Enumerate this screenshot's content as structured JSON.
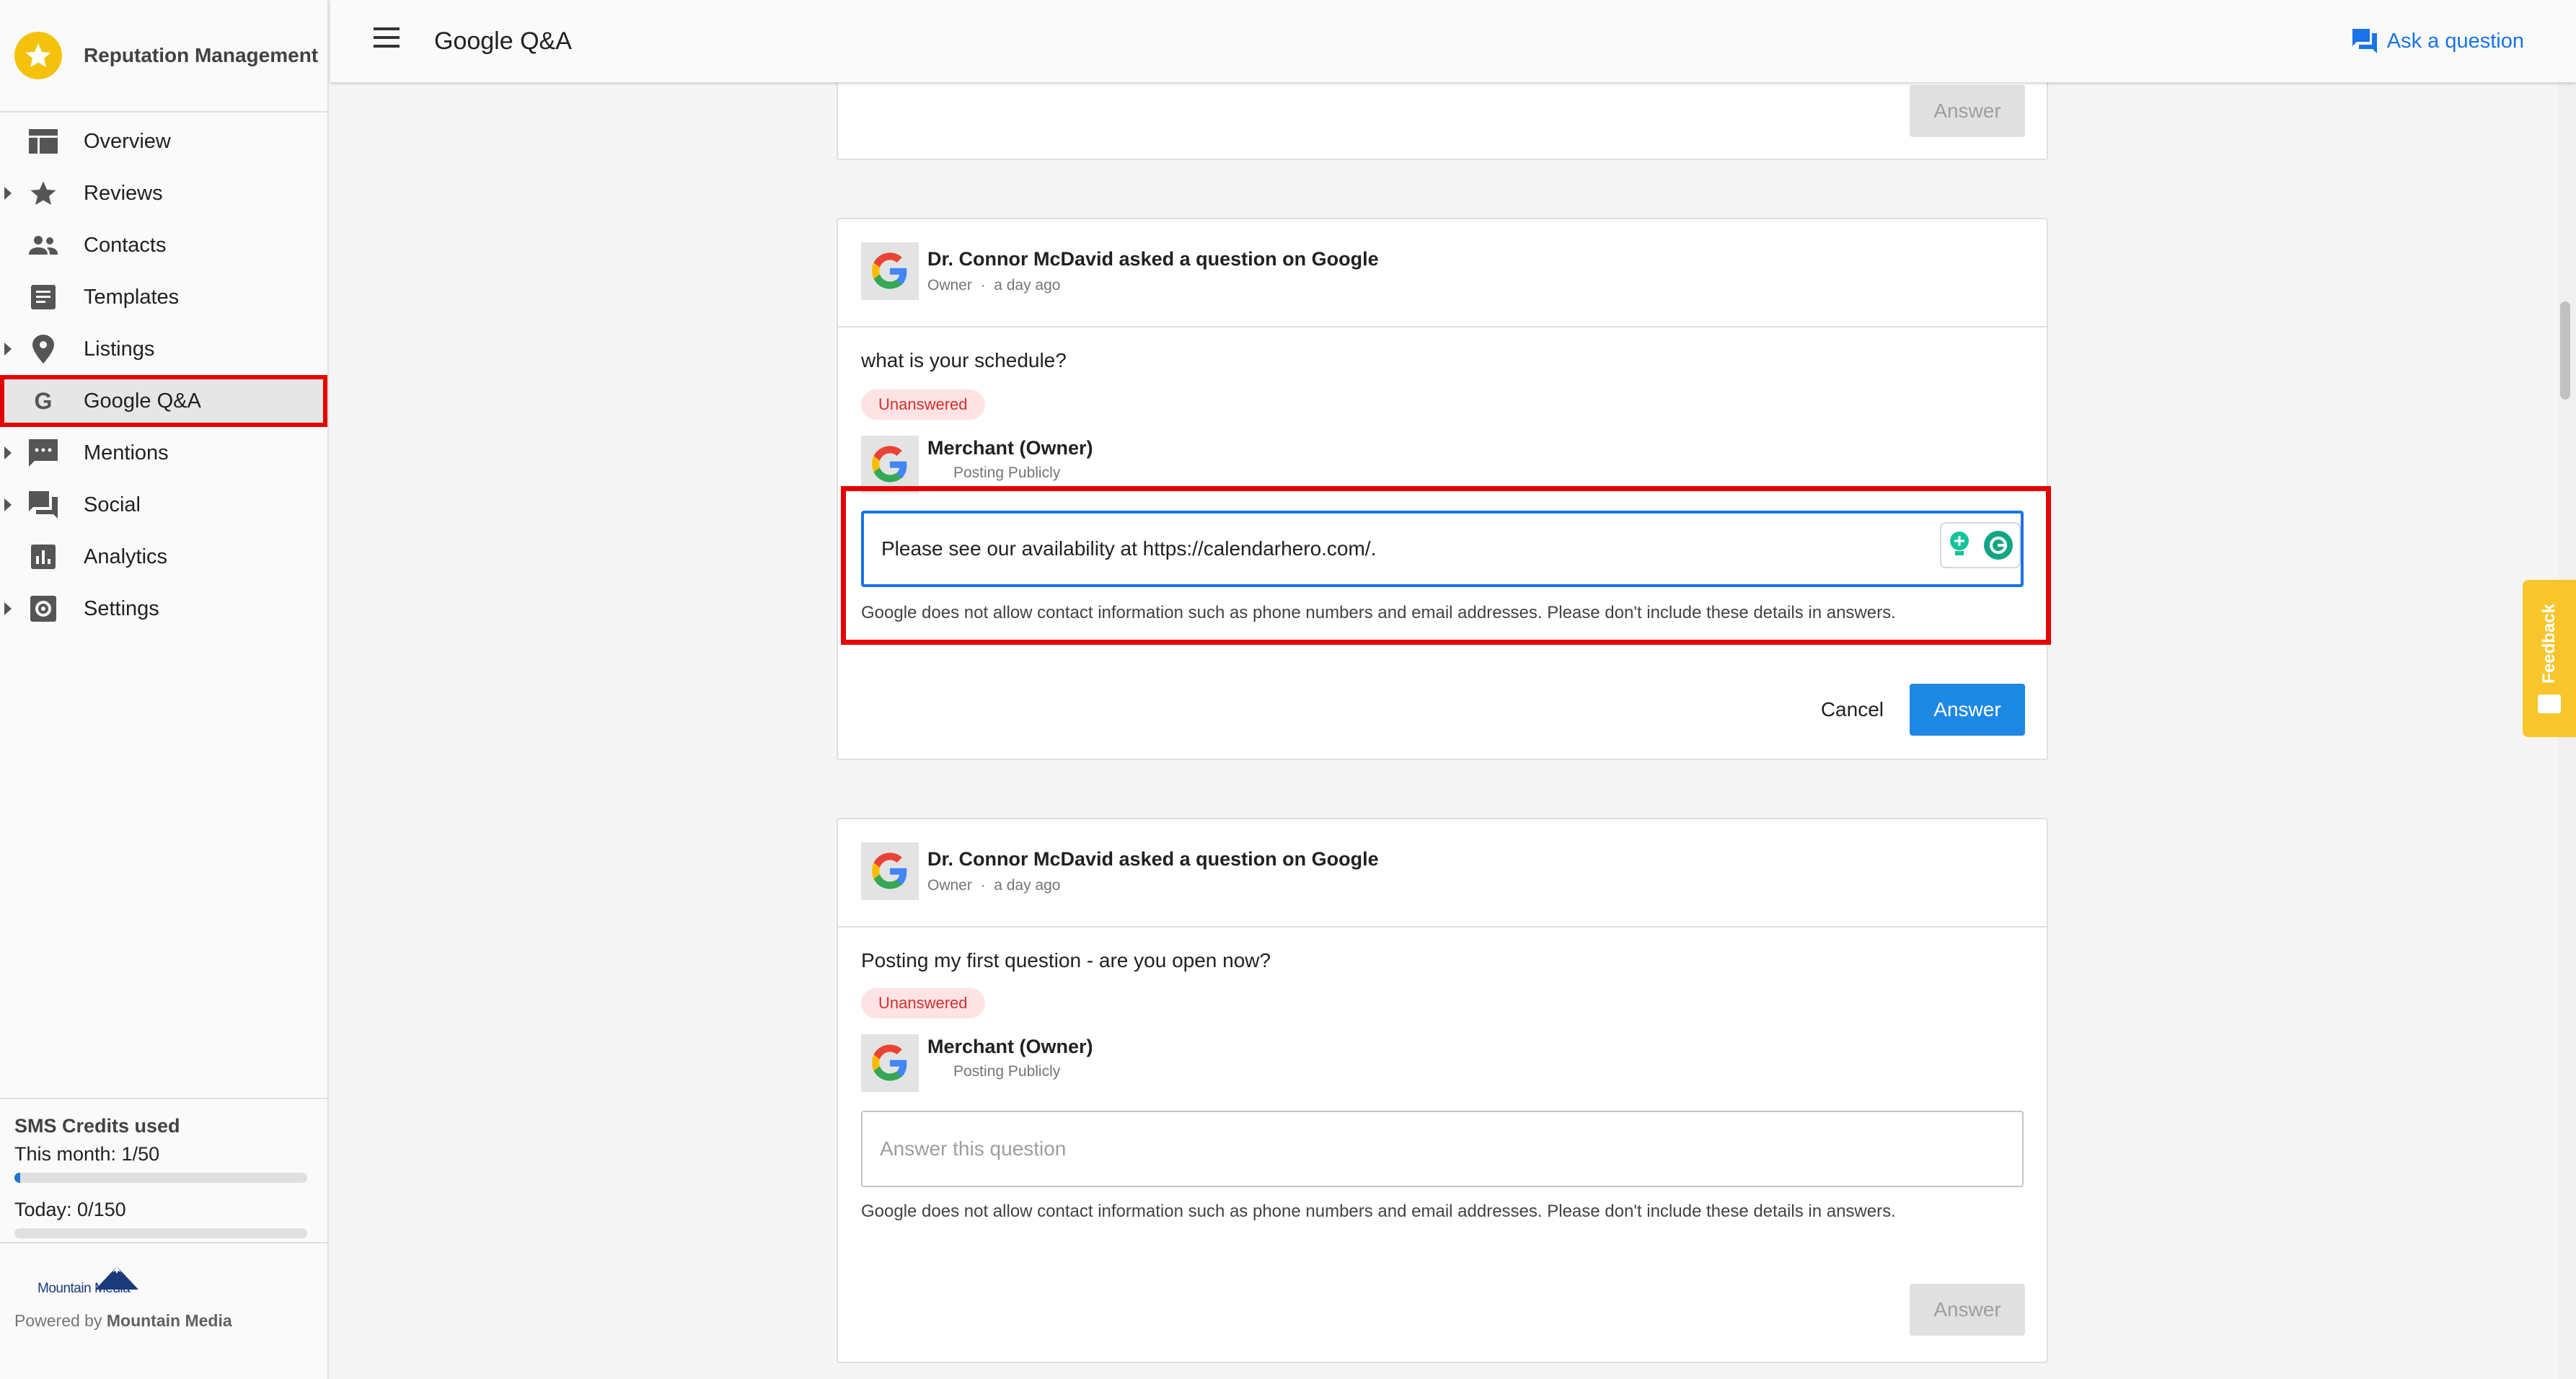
{
  "app": {
    "title": "Reputation Management"
  },
  "sidebar": {
    "items": [
      {
        "label": "Overview",
        "icon": "dashboard-icon",
        "expandable": false
      },
      {
        "label": "Reviews",
        "icon": "star-icon",
        "expandable": true
      },
      {
        "label": "Contacts",
        "icon": "people-icon",
        "expandable": false
      },
      {
        "label": "Templates",
        "icon": "document-icon",
        "expandable": false
      },
      {
        "label": "Listings",
        "icon": "location-pin-icon",
        "expandable": true
      },
      {
        "label": "Google Q&A",
        "icon": "google-g-icon",
        "expandable": false,
        "active": true
      },
      {
        "label": "Mentions",
        "icon": "comment-icon",
        "expandable": true
      },
      {
        "label": "Social",
        "icon": "forum-icon",
        "expandable": true
      },
      {
        "label": "Analytics",
        "icon": "bar-chart-icon",
        "expandable": false
      },
      {
        "label": "Settings",
        "icon": "settings-icon",
        "expandable": true
      }
    ],
    "sms": {
      "title": "SMS Credits used",
      "month_label": "This month: 1/50",
      "month_fraction": 0.02,
      "today_label": "Today: 0/150",
      "today_fraction": 0
    },
    "logo_text": "Mountain Media",
    "powered_prefix": "Powered by ",
    "powered_name": "Mountain Media"
  },
  "header": {
    "title": "Google Q&A",
    "ask_label": "Ask a question"
  },
  "feedback_label": "Feedback",
  "colors": {
    "accent": "#1a73e8",
    "primary_button": "#1e88e5",
    "badge_bg": "#fde3e3",
    "badge_text": "#d32f2f",
    "highlight": "#e50000",
    "brand": "#f4c20d"
  },
  "cards": {
    "top": {
      "answer_button": "Answer"
    },
    "first": {
      "asker": "Dr. Connor McDavid asked a question on Google",
      "role": "Owner",
      "time": "a day ago",
      "question": "what is your schedule?",
      "status": "Unanswered",
      "merchant": "Merchant (Owner)",
      "merchant_sub": "Posting Publicly",
      "answer_value": "Please see our availability at https://calendarhero.com/.",
      "hint": "Google does not allow contact information such as phone numbers and email addresses. Please don't include these details in answers.",
      "cancel": "Cancel",
      "answer_button": "Answer"
    },
    "second": {
      "asker": "Dr. Connor McDavid asked a question on Google",
      "role": "Owner",
      "time": "a day ago",
      "question": "Posting my first question - are you open now?",
      "status": "Unanswered",
      "merchant": "Merchant (Owner)",
      "merchant_sub": "Posting Publicly",
      "answer_placeholder": "Answer this question",
      "hint": "Google does not allow contact information such as phone numbers and email addresses. Please don't include these details in answers.",
      "answer_button": "Answer"
    }
  }
}
